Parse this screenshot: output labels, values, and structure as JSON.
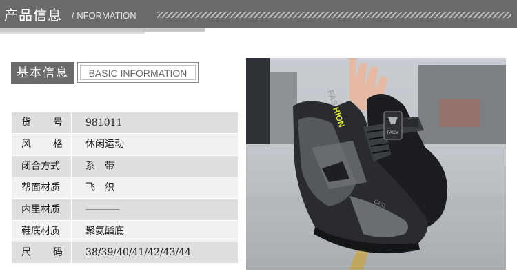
{
  "header": {
    "title_cn": "产品信息",
    "title_en": "/ NFORMATION"
  },
  "basic": {
    "title_cn": "基本信息",
    "title_en": "BASIC INFORMATION"
  },
  "specs": [
    {
      "label": "货号",
      "value": "981011"
    },
    {
      "label": "风格",
      "value": "休闲运动"
    },
    {
      "label": "闭合方式",
      "value": "系　带"
    },
    {
      "label": "帮面材质",
      "value": "飞　织"
    },
    {
      "label": "内里材质",
      "value": "————"
    },
    {
      "label": "鞋底材质",
      "value": "聚氨酯底"
    },
    {
      "label": "尺码",
      "value": "38/39/40/41/42/43/44"
    }
  ],
  "photo": {
    "shoe_text": "FASHION",
    "logo_text": "FACM",
    "bottom_text": "OHD"
  },
  "colors": {
    "header_gray": "#6a6a6a",
    "row_shade": "#dedede",
    "row_plain": "#f1f1f1",
    "accent_yellow": "#d8e23a"
  }
}
